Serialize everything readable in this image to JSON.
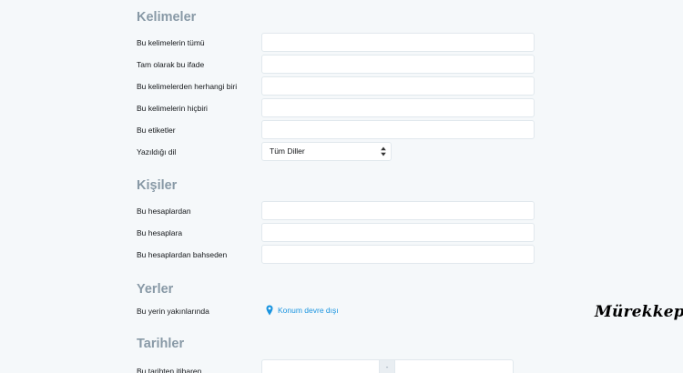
{
  "words": {
    "title": "Kelimeler",
    "all_words_label": "Bu kelimelerin tümü",
    "exact_phrase_label": "Tam olarak bu ifade",
    "any_words_label": "Bu kelimelerden herhangi biri",
    "none_words_label": "Bu kelimelerin hiçbiri",
    "hashtags_label": "Bu etiketler",
    "language_label": "Yazıldığı dil",
    "language_value": "Tüm Diller"
  },
  "people": {
    "title": "Kişiler",
    "from_label": "Bu hesaplardan",
    "to_label": "Bu hesaplara",
    "mentioning_label": "Bu hesaplardan bahseden"
  },
  "places": {
    "title": "Yerler",
    "near_label": "Bu yerin yakınlarında",
    "location_link": "Konum devre dışı",
    "location_icon": "map-pin-icon"
  },
  "dates": {
    "title": "Tarihler",
    "since_label": "Bu tarihten itibaren",
    "separator": "-"
  },
  "watermark": "Mürekkep",
  "colors": {
    "section_title": "#8899a6",
    "link": "#1b95e0",
    "background": "#f5f8fa",
    "input_border": "#e1e8ed"
  }
}
